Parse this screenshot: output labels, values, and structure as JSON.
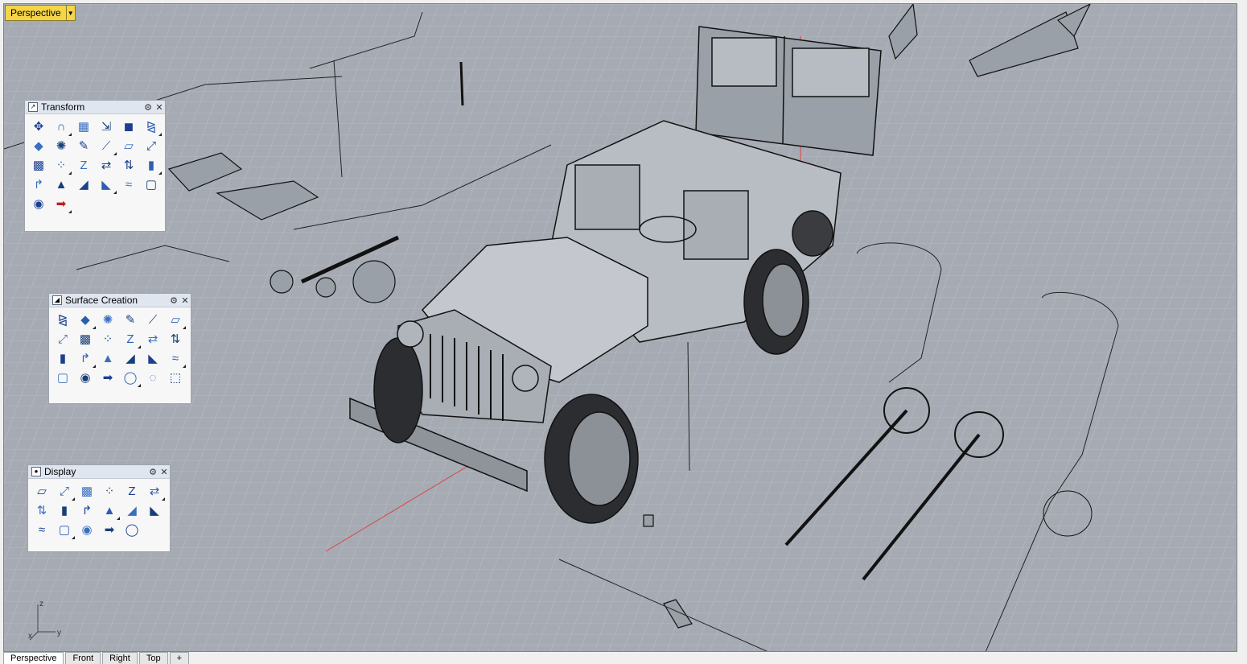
{
  "viewport": {
    "title": "Perspective",
    "grid_color": "#b8bdc4",
    "background": "#a6abb3"
  },
  "panels": {
    "transform": {
      "title": "Transform",
      "icons": [
        "move-icon",
        "rotate-arc-icon",
        "array-icon",
        "scale-icon",
        "box-icon",
        "mirror-icon",
        "diamond-icon",
        "gear-cluster-icon",
        "pen-icon",
        "line-icon",
        "shear-icon",
        "orient-icon",
        "grid-array-icon",
        "polar-array-icon",
        "z-icon",
        "align-icon",
        "flip-icon",
        "bar-icon",
        "bend-icon",
        "taper-icon",
        "twist-icon",
        "flow-icon",
        "wave-icon",
        "cage-icon",
        "smash-icon",
        "red-arrow-icon"
      ]
    },
    "surface": {
      "title": "Surface Creation",
      "icons": [
        "patch-icon",
        "sphere-icon",
        "loft-icon",
        "sweep-icon",
        "plane-icon",
        "network-icon",
        "corner-icon",
        "edge-icon",
        "extrude-icon",
        "drape-icon",
        "blend-icon",
        "heightfield-icon",
        "box-surface-icon",
        "loft2-icon",
        "cone-icon",
        "curve-icon",
        "revolve-icon",
        "rail-revolve-icon",
        "sweep1-icon",
        "sweep2-icon",
        "funnel-icon",
        "hill-icon",
        "image-icon",
        "point-grid-icon"
      ]
    },
    "display": {
      "title": "Display",
      "icons": [
        "wireframe-icon",
        "shaded-icon",
        "rendered-icon",
        "ghosted-icon",
        "xray-icon",
        "material-icon",
        "clipping-icon",
        "iso-icon",
        "technical-icon",
        "perspective-icon",
        "sun-icon",
        "pen-ball-icon",
        "section-icon",
        "mesh-icon",
        "zoom-icon",
        "hide-icon",
        "screen-icon"
      ]
    }
  },
  "tabs": [
    "Perspective",
    "Front",
    "Right",
    "Top",
    "+"
  ],
  "axes": {
    "x": "x",
    "y": "y",
    "z": "z"
  }
}
